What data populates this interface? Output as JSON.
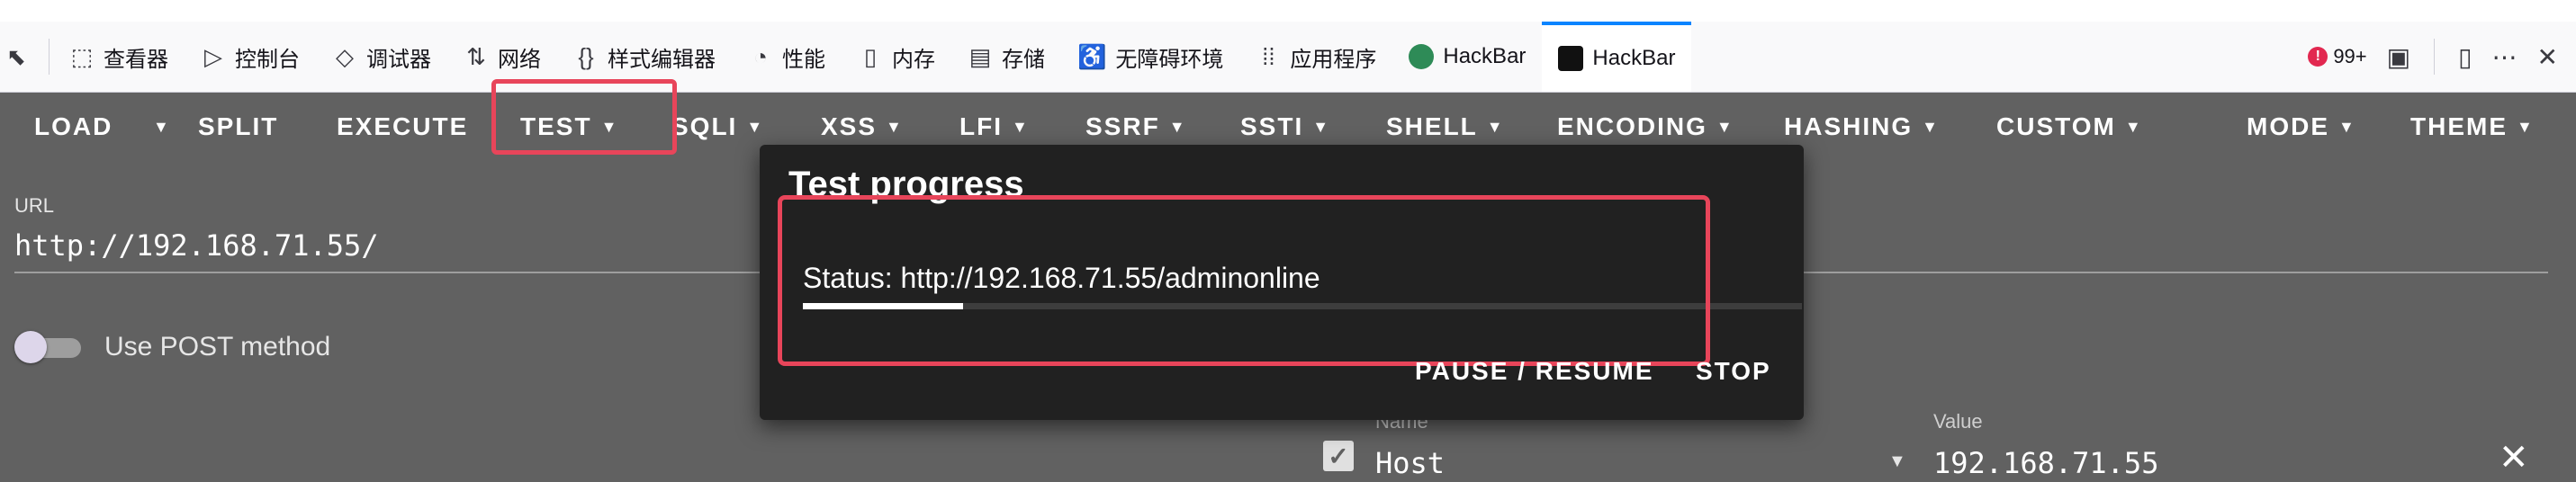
{
  "devtools": {
    "tools": [
      {
        "icon": "inspector-icon",
        "glyph": "⬚",
        "label": "查看器"
      },
      {
        "icon": "console-icon",
        "glyph": "▷",
        "label": "控制台"
      },
      {
        "icon": "debugger-icon",
        "glyph": "◇",
        "label": "调试器"
      },
      {
        "icon": "network-icon",
        "glyph": "⇅",
        "label": "网络"
      },
      {
        "icon": "style-editor-icon",
        "glyph": "{}",
        "label": "样式编辑器"
      },
      {
        "icon": "performance-icon",
        "glyph": "◔",
        "label": "性能"
      },
      {
        "icon": "memory-icon",
        "glyph": "▯",
        "label": "内存"
      },
      {
        "icon": "storage-icon",
        "glyph": "▤",
        "label": "存储"
      },
      {
        "icon": "accessibility-icon",
        "glyph": "♿",
        "label": "无障碍环境"
      },
      {
        "icon": "application-icon",
        "glyph": "⁞⁞",
        "label": "应用程序"
      },
      {
        "icon": "hackbar-logo-icon",
        "glyph": "",
        "label": "HackBar"
      },
      {
        "icon": "hackbar-active-logo-icon",
        "glyph": "",
        "label": "HackBar"
      }
    ],
    "error_count": "99+"
  },
  "toolbar": {
    "load": "LOAD",
    "split": "SPLIT",
    "execute": "EXECUTE",
    "test": "TEST",
    "sqli": "SQLI",
    "xss": "XSS",
    "lfi": "LFI",
    "ssrf": "SSRF",
    "ssti": "SSTI",
    "shell": "SHELL",
    "encoding": "ENCODING",
    "hashing": "HASHING",
    "custom": "CUSTOM",
    "mode": "MODE",
    "theme": "THEME",
    "caret": "▼"
  },
  "request": {
    "url_label": "URL",
    "url_value": "http://192.168.71.55/",
    "post_label": "Use POST method",
    "post_enabled": false
  },
  "headers": {
    "name_label": "Name",
    "value_label": "Value",
    "rows": [
      {
        "checked": true,
        "name": "Host",
        "value": "192.168.71.55"
      }
    ]
  },
  "dialog": {
    "title": "Test progress",
    "status": "Status: http://192.168.71.55/adminonline",
    "progress": 0.16,
    "pause_label": "PAUSE / RESUME",
    "stop_label": "STOP"
  },
  "colors": {
    "background": "#616161",
    "dialog": "#212121",
    "highlight": "#e8455a",
    "devtools_accent": "#0a84ff"
  }
}
